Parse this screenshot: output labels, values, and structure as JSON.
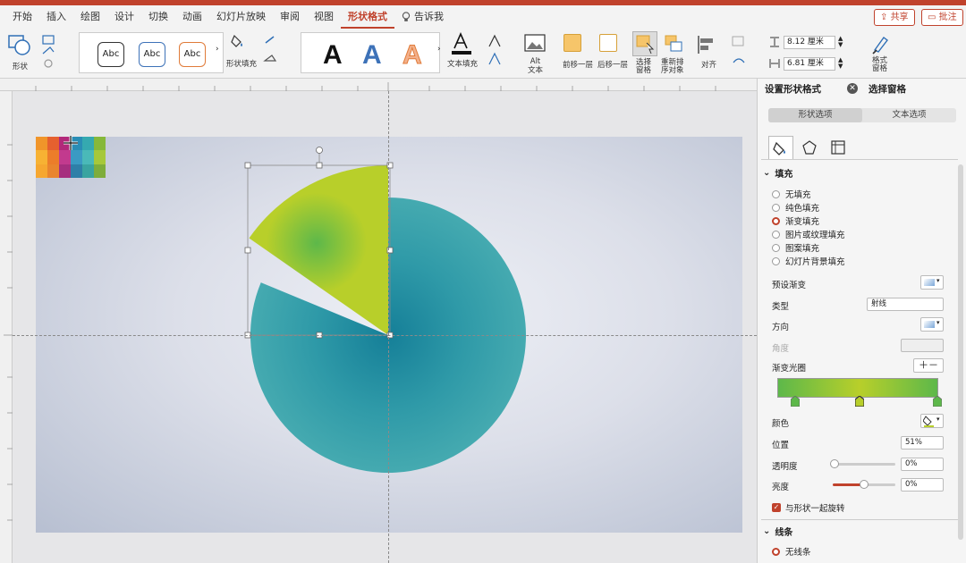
{
  "tabs": [
    "开始",
    "插入",
    "绘图",
    "设计",
    "切换",
    "动画",
    "幻灯片放映",
    "审阅",
    "视图",
    "形状格式",
    "告诉我"
  ],
  "active_tab": "形状格式",
  "header_buttons": {
    "share": "共享",
    "comment": "批注"
  },
  "ribbon": {
    "shape_label": "形状",
    "style_abc": "Abc",
    "shape_fill_label": "形状填充",
    "wordart_A": "A",
    "text_fill_label": "文本填充",
    "alt_text_label": "Alt\n文本",
    "bring_forward": "前移一层",
    "send_backward": "后移一层",
    "selection_pane": "选择\n窗格",
    "reorder_objects": "重新排\n序对象",
    "align": "对齐",
    "height_value": "8.12 厘米",
    "width_value": "6.81 厘米",
    "format_pane": "格式\n窗格"
  },
  "pane": {
    "title": "设置形状格式",
    "tab2": "选择窗格",
    "seg_shape": "形状选项",
    "seg_text": "文本选项",
    "fill_section": "填充",
    "fill_options": [
      "无填充",
      "纯色填充",
      "渐变填充",
      "图片或纹理填充",
      "图案填充",
      "幻灯片背景填充"
    ],
    "selected_fill": "渐变填充",
    "preset_gradient": "预设渐变",
    "type_label": "类型",
    "type_value": "射线",
    "direction_label": "方向",
    "angle_label": "角度",
    "gradient_stops_label": "渐变光圈",
    "color_label": "颜色",
    "position_label": "位置",
    "position_value": "51%",
    "transparency_label": "透明度",
    "transparency_value": "0%",
    "brightness_label": "亮度",
    "brightness_value": "0%",
    "rotate_with_shape": "与形状一起旋转",
    "line_section": "线条",
    "line_option": "无线条"
  },
  "colors": {
    "accent": "#c0422c",
    "teal_center": "#157f98",
    "teal_edge": "#45aab0",
    "green_center": "#5db84a",
    "yellow_green": "#b8cf2a"
  }
}
